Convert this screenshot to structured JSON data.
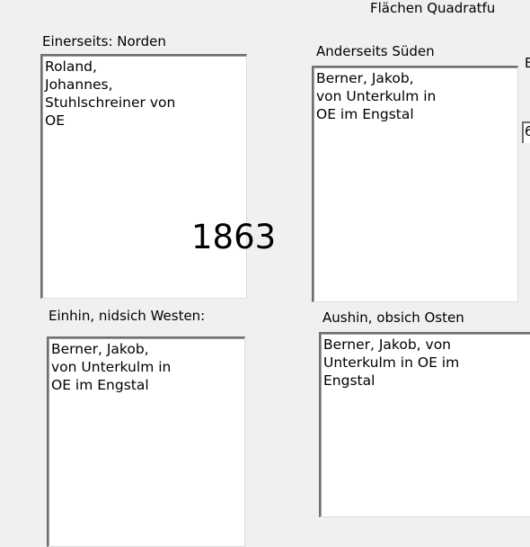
{
  "header": {
    "label": "Flächen Quadratfu"
  },
  "north": {
    "label": "Einerseits: Norden",
    "value": "Roland,\nJohannes,\nStuhlschreiner von\nOE"
  },
  "south": {
    "label": "Anderseits Süden",
    "value": "Berner, Jakob,\nvon Unterkulm in\nOE im Engstal"
  },
  "west": {
    "label": "Einhin, nidsich Westen:",
    "value": "Berner, Jakob,\nvon Unterkulm in\nOE im Engstal"
  },
  "east": {
    "label": "Aushin,  obsich Osten",
    "value": "Berner, Jakob, von\nUnterkulm in OE im\nEngstal"
  },
  "year": "1863",
  "right_edge": {
    "label_fragment": "E",
    "field_fragment": "6"
  }
}
